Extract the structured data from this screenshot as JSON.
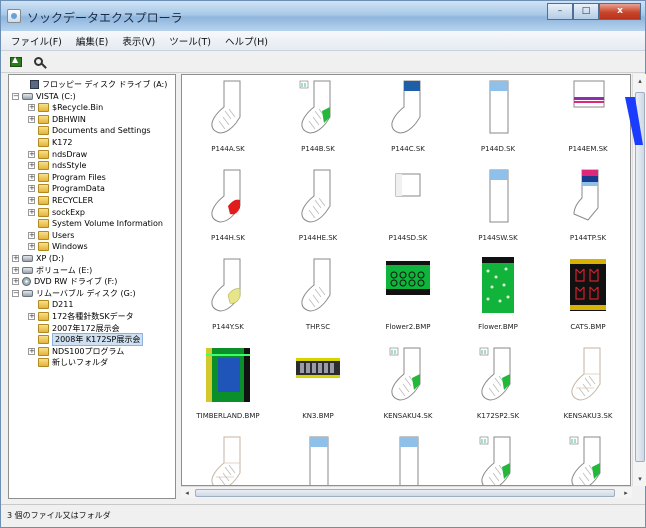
{
  "window": {
    "title": "ソックデータエクスプローラ",
    "minimize_glyph": "–",
    "maximize_glyph": "□",
    "close_glyph": "x"
  },
  "menu": [
    {
      "label": "ファイル(F)"
    },
    {
      "label": "編集(E)"
    },
    {
      "label": "表示(V)"
    },
    {
      "label": "ツール(T)"
    },
    {
      "label": "ヘルプ(H)"
    }
  ],
  "toolbar": {
    "icons": [
      "folder-up-icon",
      "search-icon"
    ]
  },
  "tree": [
    {
      "label": "フロッピー ディスク ドライブ (A:)",
      "level": 1,
      "expander": "",
      "icon": "floppy"
    },
    {
      "label": "VISTA (C:)",
      "level": 0,
      "expander": "−",
      "icon": "drive"
    },
    {
      "label": "$Recycle.Bin",
      "level": 2,
      "expander": "+",
      "icon": "folder"
    },
    {
      "label": "DBHWIN",
      "level": 2,
      "expander": "+",
      "icon": "folder"
    },
    {
      "label": "Documents and Settings",
      "level": 2,
      "expander": "",
      "icon": "folder"
    },
    {
      "label": "K172",
      "level": 2,
      "expander": "",
      "icon": "folder"
    },
    {
      "label": "ndsDraw",
      "level": 2,
      "expander": "+",
      "icon": "folder"
    },
    {
      "label": "ndsStyle",
      "level": 2,
      "expander": "+",
      "icon": "folder"
    },
    {
      "label": "Program Files",
      "level": 2,
      "expander": "+",
      "icon": "folder"
    },
    {
      "label": "ProgramData",
      "level": 2,
      "expander": "+",
      "icon": "folder"
    },
    {
      "label": "RECYCLER",
      "level": 2,
      "expander": "+",
      "icon": "folder"
    },
    {
      "label": "sockExp",
      "level": 2,
      "expander": "+",
      "icon": "folder"
    },
    {
      "label": "System Volume Information",
      "level": 2,
      "expander": "",
      "icon": "folder"
    },
    {
      "label": "Users",
      "level": 2,
      "expander": "+",
      "icon": "folder"
    },
    {
      "label": "Windows",
      "level": 2,
      "expander": "+",
      "icon": "folder"
    },
    {
      "label": "XP (D:)",
      "level": 0,
      "expander": "+",
      "icon": "drive"
    },
    {
      "label": "ボリューム (E:)",
      "level": 0,
      "expander": "+",
      "icon": "drive"
    },
    {
      "label": "DVD RW ドライブ (F:)",
      "level": 0,
      "expander": "+",
      "icon": "dvd"
    },
    {
      "label": "リムーバブル ディスク (G:)",
      "level": 0,
      "expander": "−",
      "icon": "drive"
    },
    {
      "label": "D211",
      "level": 2,
      "expander": "",
      "icon": "folder"
    },
    {
      "label": "172各種針数SKデータ",
      "level": 2,
      "expander": "+",
      "icon": "folder"
    },
    {
      "label": "2007年172展示会",
      "level": 2,
      "expander": "",
      "icon": "folder"
    },
    {
      "label": "2008年 K172SP展示会",
      "level": 2,
      "expander": "",
      "icon": "folder",
      "selected": true
    },
    {
      "label": "NDS100プログラム",
      "level": 2,
      "expander": "+",
      "icon": "folder"
    },
    {
      "label": "新しいフォルダ",
      "level": 2,
      "expander": "",
      "icon": "folder"
    }
  ],
  "files": [
    {
      "name": "P144A.SK",
      "kind": "sock-plain"
    },
    {
      "name": "P144B.SK",
      "kind": "sock-green-toe"
    },
    {
      "name": "P144C.SK",
      "kind": "sock-blue-band"
    },
    {
      "name": "P144D.SK",
      "kind": "tube-blue-top"
    },
    {
      "name": "P144EM.SK",
      "kind": "tube-pink-band"
    },
    {
      "name": "P144H.SK",
      "kind": "sock-red-heel"
    },
    {
      "name": "P144HE.SK",
      "kind": "sock-plain"
    },
    {
      "name": "P144SD.SK",
      "kind": "short-tube"
    },
    {
      "name": "P144SW.SK",
      "kind": "tube-blue-top"
    },
    {
      "name": "P144TP.SK",
      "kind": "sock-magenta-top"
    },
    {
      "name": "P144Y.SK",
      "kind": "sock-yellow-heel"
    },
    {
      "name": "THP.SC",
      "kind": "sock-plain"
    },
    {
      "name": "Flower2.BMP",
      "kind": "bmp-green-black"
    },
    {
      "name": "Flower.BMP",
      "kind": "bmp-green-dots"
    },
    {
      "name": "CATS.BMP",
      "kind": "bmp-black-cats"
    },
    {
      "name": "TIMBERLAND.BMP",
      "kind": "bmp-timberland"
    },
    {
      "name": "KN3.BMP",
      "kind": "bmp-kn3"
    },
    {
      "name": "KENSAKU4.SK",
      "kind": "sock-green-toe"
    },
    {
      "name": "K172SP2.SK",
      "kind": "sock-green-toe"
    },
    {
      "name": "KENSAKU3.SK",
      "kind": "sock-faint"
    },
    {
      "name": "",
      "kind": "sock-faint"
    },
    {
      "name": "",
      "kind": "tube-blue-top"
    },
    {
      "name": "",
      "kind": "tube-blue-top"
    },
    {
      "name": "",
      "kind": "sock-green-toe"
    },
    {
      "name": "",
      "kind": "sock-green-toe"
    }
  ],
  "scroll": {
    "left_arrow": "◂",
    "right_arrow": "▸",
    "up_arrow": "▴",
    "down_arrow": "▾"
  },
  "status": {
    "text": "3 個のファイル又はフォルダ"
  },
  "colors": {
    "accent": "#1a3cff",
    "selection": "#cfe0f2",
    "sock_green": "#22b83a",
    "sock_blue": "#8fc0ea",
    "sock_red": "#e21b1b",
    "sock_magenta": "#e0287a",
    "sock_yellow": "#e7e58a"
  }
}
